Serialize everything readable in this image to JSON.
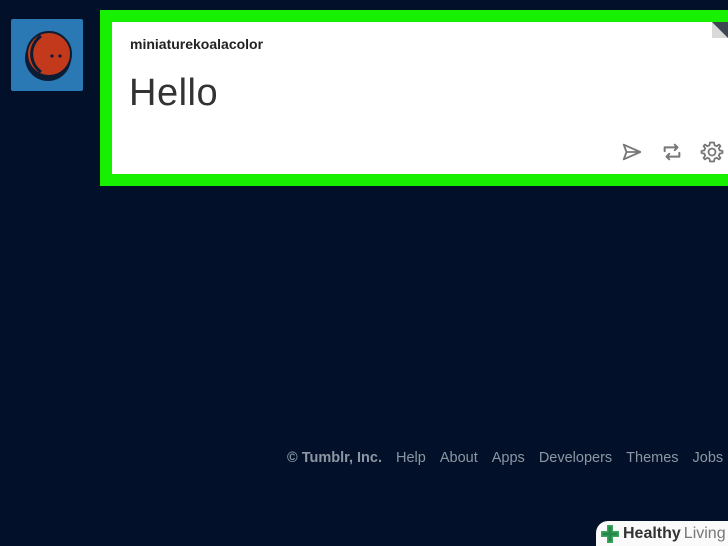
{
  "post": {
    "author": "miniaturekoalacolor",
    "body": "Hello",
    "actions": [
      {
        "name": "share",
        "icon": "paper-plane-icon"
      },
      {
        "name": "reblog",
        "icon": "reblog-icon"
      },
      {
        "name": "settings",
        "icon": "gear-icon"
      }
    ]
  },
  "avatar": {
    "background": "#2a79b4",
    "face_color": "#c23a1b"
  },
  "highlight_color": "#17f000",
  "footer": {
    "copyright": "© Tumblr, Inc.",
    "links": [
      "Help",
      "About",
      "Apps",
      "Developers",
      "Themes",
      "Jobs"
    ]
  },
  "watermark": {
    "text_bold": "Healthy",
    "text_light": "Living",
    "icon": "green-cross-icon"
  }
}
